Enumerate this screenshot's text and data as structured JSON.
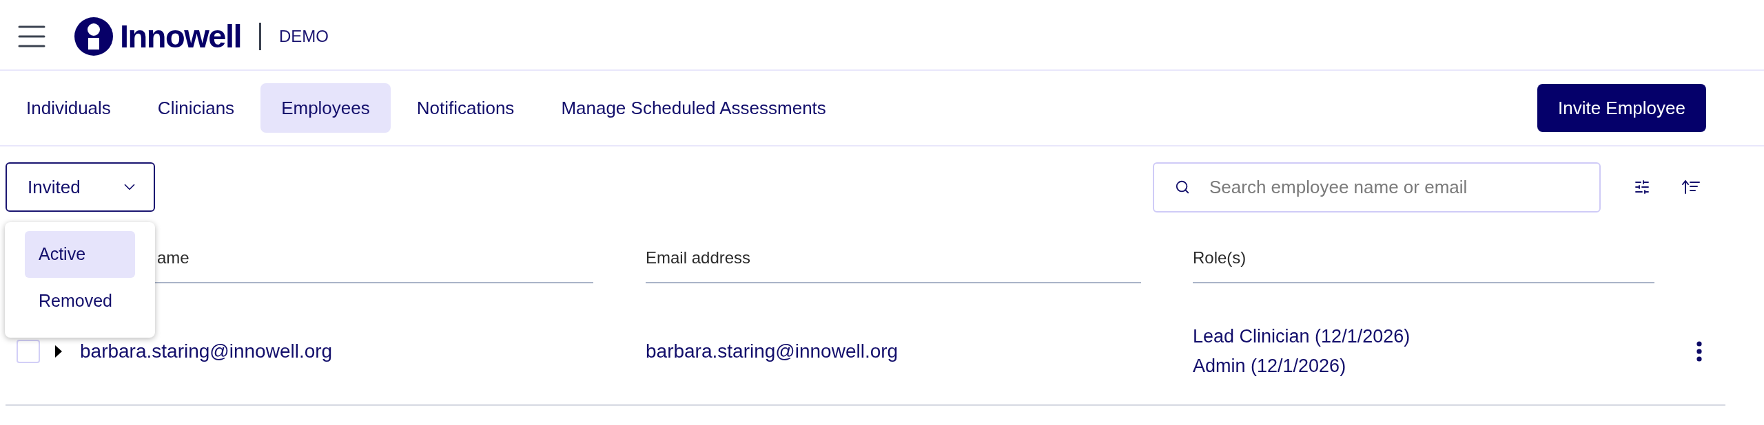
{
  "header": {
    "logo_text": "Innowell",
    "environment": "DEMO"
  },
  "tabs": [
    {
      "label": "Individuals",
      "selected": false
    },
    {
      "label": "Clinicians",
      "selected": false
    },
    {
      "label": "Employees",
      "selected": true
    },
    {
      "label": "Notifications",
      "selected": false
    },
    {
      "label": "Manage Scheduled Assessments",
      "selected": false
    }
  ],
  "primary_action": {
    "label": "Invite Employee"
  },
  "status_filter": {
    "value": "Invited",
    "expanded": true,
    "options": [
      {
        "label": "Active",
        "selected": true
      },
      {
        "label": "Removed",
        "selected": false
      }
    ]
  },
  "search": {
    "placeholder": "Search employee name or email"
  },
  "table": {
    "columns": [
      "ame",
      "Email address",
      "Role(s)"
    ],
    "rows": [
      {
        "checked": false,
        "expanded": false,
        "name": "barbara.staring@innowell.org",
        "email": "barbara.staring@innowell.org",
        "roles": [
          "Lead Clinician (12/1/2026)",
          "Admin (12/1/2026)"
        ]
      }
    ]
  }
}
